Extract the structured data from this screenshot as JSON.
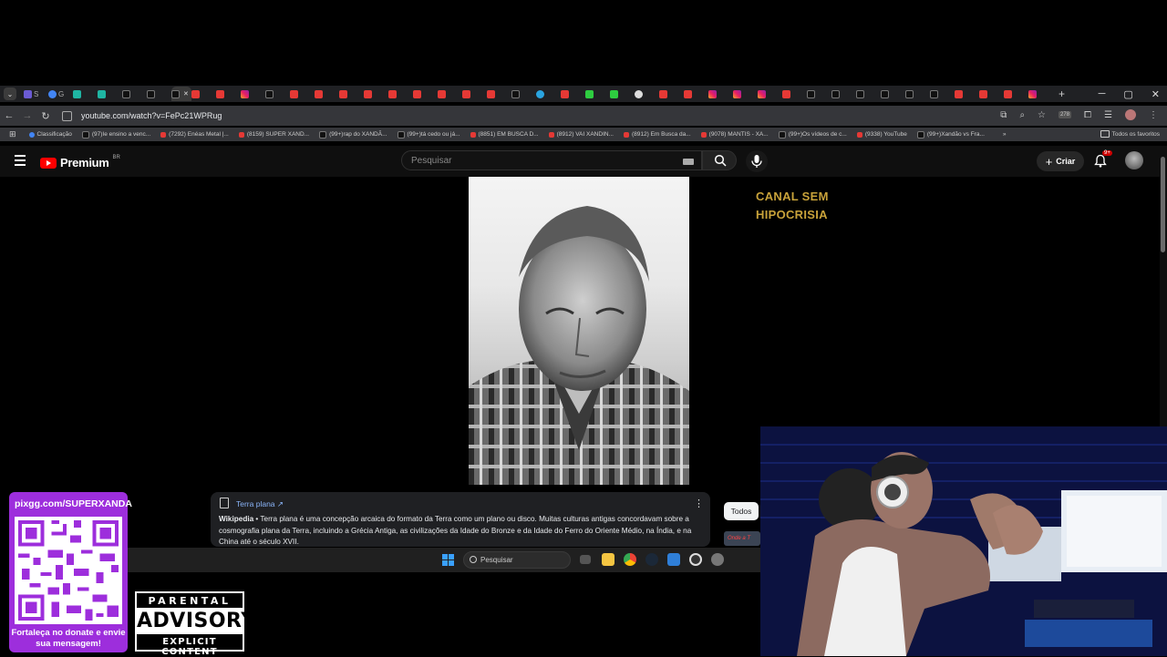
{
  "browser": {
    "tab_count_hint": "many tabs",
    "tabs": [
      {
        "icon": "s",
        "label": "S"
      },
      {
        "icon": "g",
        "label": "G"
      },
      {
        "icon": "cd",
        "label": ""
      },
      {
        "icon": "cd",
        "label": ""
      },
      {
        "icon": "tt",
        "label": ""
      },
      {
        "icon": "tt",
        "label": ""
      },
      {
        "icon": "tt",
        "label": "",
        "active": true
      },
      {
        "icon": "yt",
        "label": ""
      },
      {
        "icon": "yt",
        "label": ""
      },
      {
        "icon": "ig",
        "label": ""
      },
      {
        "icon": "tt",
        "label": ""
      },
      {
        "icon": "yt",
        "label": ""
      },
      {
        "icon": "yt",
        "label": ""
      },
      {
        "icon": "yt",
        "label": ""
      },
      {
        "icon": "yt",
        "label": ""
      },
      {
        "icon": "yt",
        "label": ""
      },
      {
        "icon": "yt",
        "label": ""
      },
      {
        "icon": "yt",
        "label": ""
      },
      {
        "icon": "yt",
        "label": ""
      },
      {
        "icon": "yt",
        "label": ""
      },
      {
        "icon": "tt",
        "label": ""
      },
      {
        "icon": "tg",
        "label": ""
      },
      {
        "icon": "yt",
        "label": ""
      },
      {
        "icon": "k",
        "label": ""
      },
      {
        "icon": "k",
        "label": ""
      },
      {
        "icon": "ch",
        "label": ""
      },
      {
        "icon": "yt",
        "label": ""
      },
      {
        "icon": "yt",
        "label": ""
      },
      {
        "icon": "ig",
        "label": ""
      },
      {
        "icon": "ig",
        "label": ""
      },
      {
        "icon": "ig",
        "label": ""
      },
      {
        "icon": "yt",
        "label": ""
      },
      {
        "icon": "tt",
        "label": ""
      },
      {
        "icon": "tt",
        "label": ""
      },
      {
        "icon": "tt",
        "label": ""
      },
      {
        "icon": "tt",
        "label": ""
      },
      {
        "icon": "tt",
        "label": ""
      },
      {
        "icon": "tt",
        "label": ""
      },
      {
        "icon": "yt",
        "label": ""
      },
      {
        "icon": "yt",
        "label": ""
      },
      {
        "icon": "yt",
        "label": ""
      },
      {
        "icon": "ig",
        "label": ""
      }
    ],
    "url": "youtube.com/watch?v=FePc21WPRug",
    "bookmarks": [
      {
        "icon": "g",
        "label": "Classificação"
      },
      {
        "icon": "tt",
        "label": "(97)Ie ensino a venc..."
      },
      {
        "icon": "yt",
        "label": "(7292) Enéas Metal |..."
      },
      {
        "icon": "yt",
        "label": "(8159) SUPER XAND..."
      },
      {
        "icon": "tt",
        "label": "(99+)rap do XANDÃ..."
      },
      {
        "icon": "tt",
        "label": "(99+)tá cedo ou já..."
      },
      {
        "icon": "yt",
        "label": "(8851) EM BUSCA D..."
      },
      {
        "icon": "yt",
        "label": "(8912) VAI XANDIN..."
      },
      {
        "icon": "yt",
        "label": "(8912) Em Busca da..."
      },
      {
        "icon": "yt",
        "label": "(9078) MANTIS - XA..."
      },
      {
        "icon": "tt",
        "label": "(99+)Os vídeos de c..."
      },
      {
        "icon": "yt",
        "label": "(9338) YouTube"
      },
      {
        "icon": "tt",
        "label": "(99+)Xandão vs Fra..."
      }
    ],
    "all_bookmarks": "Todos os favoritos",
    "profile_badge": "278"
  },
  "youtube": {
    "logo_text": "Premium",
    "country": "BR",
    "search_placeholder": "Pesquisar",
    "create_label": "Criar",
    "notif_badge": "9+"
  },
  "video": {
    "overlay_text": "CANAL SEM HIPOCRISIA"
  },
  "google_card": {
    "link_label": "Terra plana",
    "source": "Wikipedia",
    "snippet": " • Terra plana é uma concepção arcaica do formato da Terra como um plano ou disco. Muitas culturas antigas concordavam sobre a cosmografia plana da Terra, incluindo a Grécia Antiga, as civilizações da Idade do Bronze e da Idade do Ferro do Oriente Médio, na Índia, e na China até o século XVII.",
    "todos_label": "Todos",
    "chip_text": "Onde a T"
  },
  "taskbar": {
    "search_label": "Pesquisar"
  },
  "donate": {
    "url": "pixgg.com/SUPERXANDA",
    "message": "Fortaleça no donate e envie sua mensagem!",
    "accent": "#9d2edc"
  },
  "advisory": {
    "top": "PARENTAL",
    "mid": "ADVISORY",
    "bottom": "EXPLICIT CONTENT"
  }
}
